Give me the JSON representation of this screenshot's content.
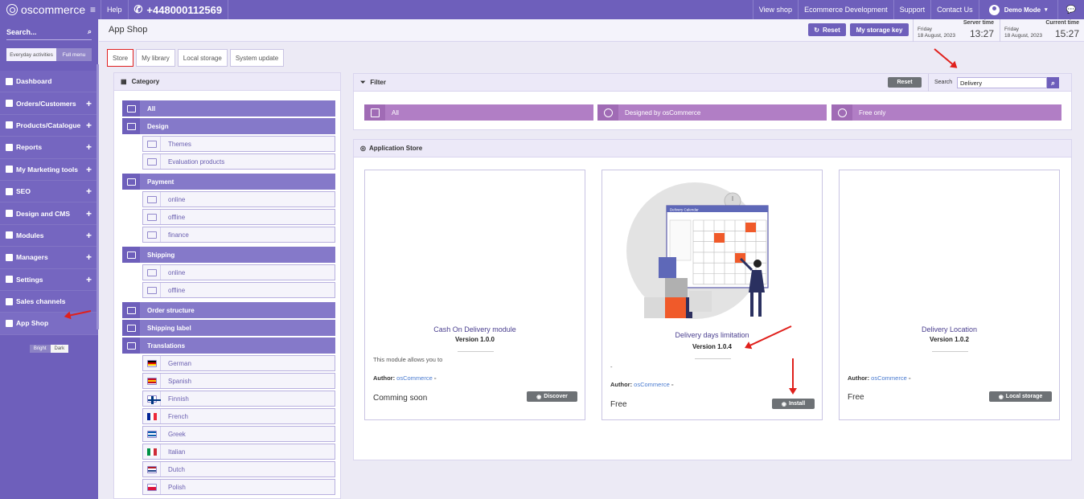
{
  "topbar": {
    "brand": "oscommerce",
    "help": "Help",
    "phone": "+448000112569",
    "links": [
      "View shop",
      "Ecommerce Development",
      "Support",
      "Contact Us"
    ],
    "user": "Demo Mode"
  },
  "sidebar": {
    "search_placeholder": "Search...",
    "toggle": [
      "Everyday activities",
      "Full menu"
    ],
    "items": [
      {
        "label": "Dashboard",
        "expandable": false
      },
      {
        "label": "Orders/Customers",
        "expandable": true
      },
      {
        "label": "Products/Catalogue",
        "expandable": true
      },
      {
        "label": "Reports",
        "expandable": true
      },
      {
        "label": "My Marketing tools",
        "expandable": true
      },
      {
        "label": "SEO",
        "expandable": true
      },
      {
        "label": "Design and CMS",
        "expandable": true
      },
      {
        "label": "Modules",
        "expandable": true
      },
      {
        "label": "Managers",
        "expandable": true
      },
      {
        "label": "Settings",
        "expandable": true
      },
      {
        "label": "Sales channels",
        "expandable": false
      },
      {
        "label": "App Shop",
        "expandable": false
      }
    ],
    "theme": [
      "Bright",
      "Dark"
    ]
  },
  "header": {
    "title": "App Shop",
    "reset": "Reset",
    "storage_key": "My storage key",
    "server_time_label": "Server time",
    "server_day": "Friday",
    "server_date": "18 August, 2023",
    "server_time": "13:27",
    "current_time_label": "Current time",
    "current_day": "Friday",
    "current_date": "18 August, 2023",
    "current_time": "15:27"
  },
  "tabs": [
    "Store",
    "My library",
    "Local storage",
    "System update"
  ],
  "category": {
    "title": "Category",
    "all": "All",
    "design": "Design",
    "design_items": [
      "Themes",
      "Evaluation products"
    ],
    "payment": "Payment",
    "payment_items": [
      "online",
      "offline",
      "finance"
    ],
    "shipping": "Shipping",
    "shipping_items": [
      "online",
      "offline"
    ],
    "order_structure": "Order structure",
    "shipping_label": "Shipping label",
    "translations": "Translations",
    "languages": [
      "German",
      "Spanish",
      "Finnish",
      "French",
      "Greek",
      "Italian",
      "Dutch",
      "Polish"
    ]
  },
  "filter": {
    "title": "Filter",
    "reset": "Reset",
    "search_label": "Search",
    "search_value": "Delivery",
    "buttons": [
      "All",
      "Designed by osCommerce",
      "Free only"
    ]
  },
  "store": {
    "title": "Application Store",
    "cards": [
      {
        "name": "Cash On Delivery module",
        "version": "Version 1.0.0",
        "desc": "This module allows you to",
        "author_label": "Author:",
        "author": "osCommerce",
        "price": "Comming soon",
        "action": "Discover"
      },
      {
        "name": "Delivery days limitation",
        "version": "Version 1.0.4",
        "desc": "-",
        "author_label": "Author:",
        "author": "osCommerce",
        "price": "Free",
        "action": "Install",
        "illus_title": "Delivery Calendar"
      },
      {
        "name": "Delivery Location",
        "version": "Version 1.0.2",
        "desc": "",
        "author_label": "Author:",
        "author": "osCommerce",
        "price": "Free",
        "action": "Local storage"
      }
    ]
  },
  "colors": {
    "primary": "#6e5fbb",
    "filter": "#b17ec5",
    "arrow": "#e0201c",
    "accent_orange": "#f05a2a"
  }
}
